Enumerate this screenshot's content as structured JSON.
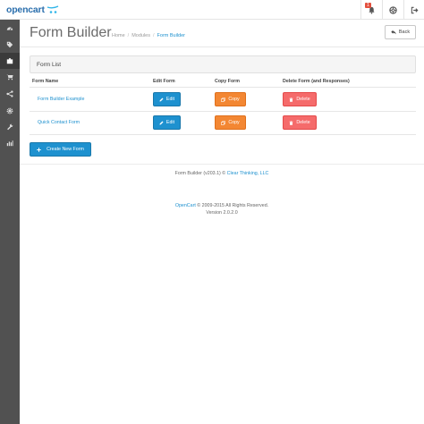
{
  "header": {
    "logo_text": "opencart",
    "notification_count": "1"
  },
  "sidebar": {
    "items": [
      {
        "icon": "dashboard-icon"
      },
      {
        "icon": "tags-icon"
      },
      {
        "icon": "puzzle-piece-icon",
        "active": true
      },
      {
        "icon": "shopping-cart-icon"
      },
      {
        "icon": "share-icon"
      },
      {
        "icon": "cog-icon"
      },
      {
        "icon": "wrench-icon"
      },
      {
        "icon": "bar-chart-icon"
      }
    ]
  },
  "page": {
    "title": "Form Builder",
    "breadcrumb": [
      "Home",
      "Modules",
      "Form Builder"
    ],
    "back_label": "Back"
  },
  "panel": {
    "title": "Form List"
  },
  "table": {
    "headers": [
      "Form Name",
      "Edit Form",
      "Copy Form",
      "Delete Form (and Responses)"
    ],
    "rows": [
      {
        "name": "Form Builder Example",
        "edit": "Edit",
        "copy": "Copy",
        "delete": "Delete"
      },
      {
        "name": "Quick Contact Form",
        "edit": "Edit",
        "copy": "Copy",
        "delete": "Delete"
      }
    ]
  },
  "create_button": "Create New Form",
  "footer": {
    "line1_prefix": "Form Builder (v203.1) © ",
    "line1_link": "Clear Thinking, LLC",
    "line2_link": "OpenCart",
    "line2_suffix": " © 2009-2015 All Rights Reserved.",
    "line3": "Version 2.0.2.0"
  },
  "colors": {
    "primary": "#1e91cf",
    "warning": "#f38733",
    "danger": "#f56b6b",
    "sidebar": "#515151"
  }
}
